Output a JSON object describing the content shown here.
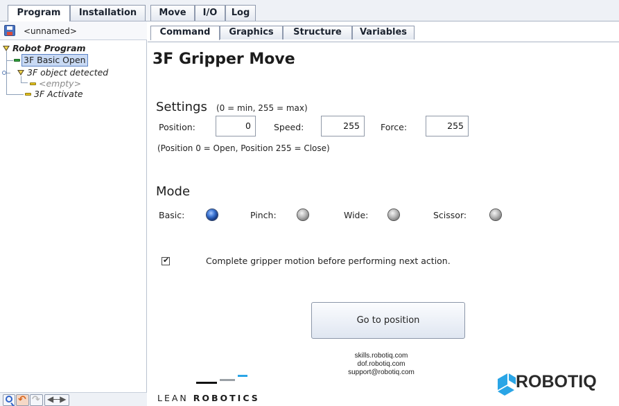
{
  "top_tabs": [
    {
      "label": "Program",
      "active": true
    },
    {
      "label": "Installation",
      "active": false
    },
    {
      "label": "Move",
      "active": false
    },
    {
      "label": "I/O",
      "active": false
    },
    {
      "label": "Log",
      "active": false
    }
  ],
  "left_panel": {
    "file_name": "<unnamed>",
    "tree": {
      "root": "Robot Program",
      "items": [
        {
          "label": "3F Basic Open",
          "selected": true,
          "marker": "green"
        },
        {
          "label": "3F object detected",
          "type": "folder"
        },
        {
          "label": "<empty>",
          "marker": "yellow"
        },
        {
          "label": "3F Activate",
          "marker": "yellow"
        }
      ]
    },
    "bottom_icons": [
      "search-icon",
      "undo-icon",
      "redo-icon",
      "move-arrows-icon"
    ]
  },
  "sub_tabs": [
    {
      "label": "Command",
      "active": true
    },
    {
      "label": "Graphics",
      "active": false
    },
    {
      "label": "Structure",
      "active": false
    },
    {
      "label": "Variables",
      "active": false
    }
  ],
  "main": {
    "title": "3F Gripper Move",
    "settings": {
      "heading": "Settings",
      "hint": "(0 = min, 255 = max)",
      "position_label": "Position:",
      "position_value": "0",
      "speed_label": "Speed:",
      "speed_value": "255",
      "force_label": "Force:",
      "force_value": "255",
      "note": "(Position 0 = Open, Position 255 = Close)"
    },
    "mode": {
      "heading": "Mode",
      "options": [
        {
          "label": "Basic:",
          "selected": true
        },
        {
          "label": "Pinch:",
          "selected": false
        },
        {
          "label": "Wide:",
          "selected": false
        },
        {
          "label": "Scissor:",
          "selected": false
        }
      ]
    },
    "complete_motion": {
      "checked": true,
      "label": "Complete gripper motion before performing next action."
    },
    "go_button_label": "Go to position"
  },
  "footer": {
    "lean_prefix": "LEAN",
    "lean_bold": "ROBOTICS",
    "contacts": [
      "skills.robotiq.com",
      "dof.robotiq.com",
      "support@robotiq.com"
    ],
    "brand": "ROBOTIQ"
  },
  "colors": {
    "accent_blue": "#3f78d6",
    "robotiq_blue": "#2aa5e6",
    "tree_selection": "#c9daf4"
  }
}
